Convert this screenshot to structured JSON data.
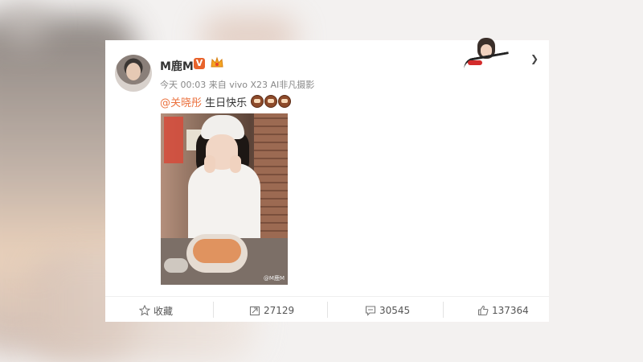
{
  "post": {
    "author": "M鹿M",
    "verified_badge": "V",
    "meta": "今天 00:03 来自 vivo X23 AI非凡摄影",
    "mention": "@关晓彤",
    "text": " 生日快乐",
    "photo_watermark": "@M鹿M"
  },
  "actions": {
    "favorite_label": "收藏",
    "repost_count": "27129",
    "comment_count": "30545",
    "like_count": "137364"
  },
  "colors": {
    "accent": "#eb7340",
    "badge": "#e8632c"
  },
  "icons": [
    "star-icon",
    "repost-icon",
    "comment-icon",
    "like-icon",
    "crown-icon",
    "cake-emoji-icon",
    "chevron-down-icon"
  ]
}
